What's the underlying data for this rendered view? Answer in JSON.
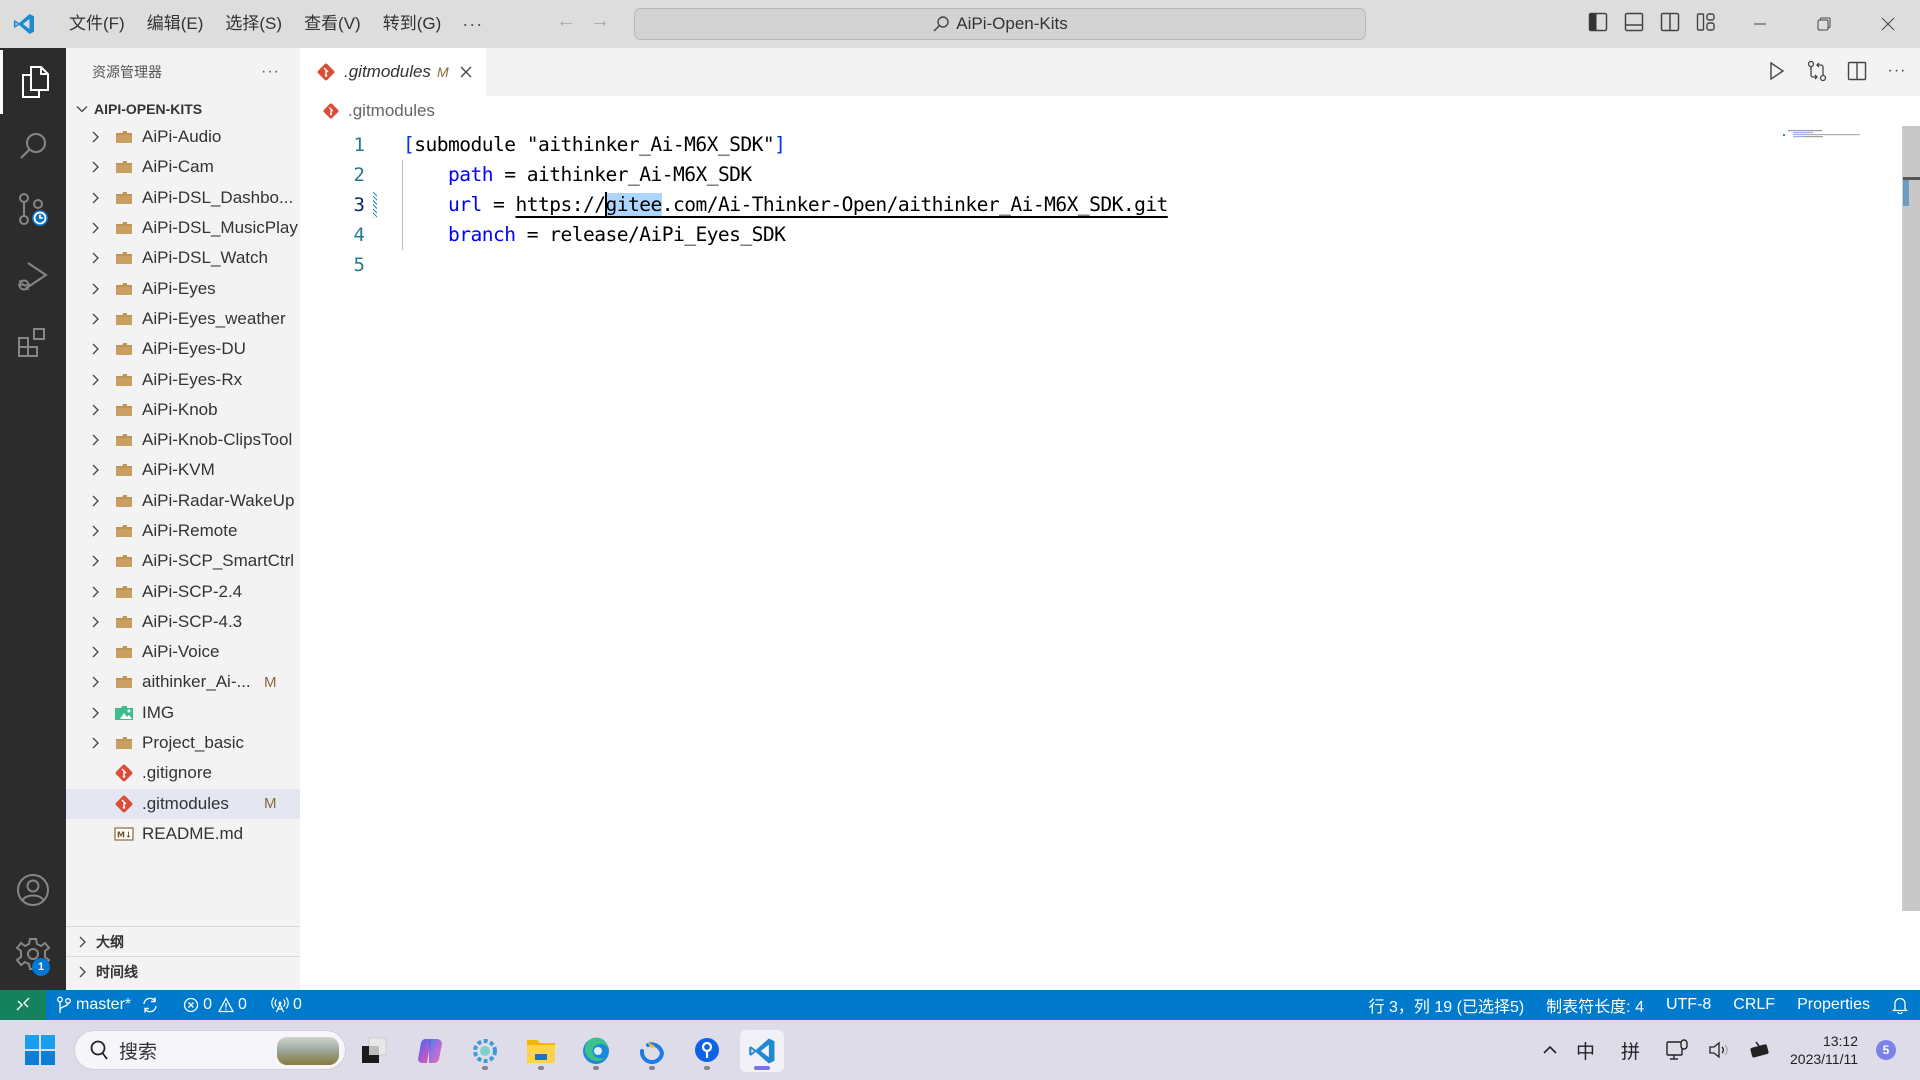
{
  "titlebar": {
    "menus": [
      "文件(F)",
      "编辑(E)",
      "选择(S)",
      "查看(V)",
      "转到(G)"
    ],
    "more_label": "···",
    "command_center_text": "AiPi-Open-Kits"
  },
  "activitybar": {
    "items": [
      {
        "name": "explorer",
        "icon": "files-icon",
        "active": true
      },
      {
        "name": "search",
        "icon": "search-icon"
      },
      {
        "name": "source-control",
        "icon": "source-control-icon"
      },
      {
        "name": "run-debug",
        "icon": "run-debug-icon"
      },
      {
        "name": "extensions",
        "icon": "extensions-icon"
      }
    ],
    "accounts_icon": "account-icon",
    "manage_icon": "gear-icon",
    "manage_badge": "1"
  },
  "sidebar": {
    "title": "资源管理器",
    "more_label": "···",
    "workspace_name": "AIPI-OPEN-KITS",
    "tree": [
      {
        "label": "AiPi-Audio",
        "type": "folder"
      },
      {
        "label": "AiPi-Cam",
        "type": "folder"
      },
      {
        "label": "AiPi-DSL_Dashbo...",
        "type": "folder"
      },
      {
        "label": "AiPi-DSL_MusicPlay",
        "type": "folder"
      },
      {
        "label": "AiPi-DSL_Watch",
        "type": "folder"
      },
      {
        "label": "AiPi-Eyes",
        "type": "folder"
      },
      {
        "label": "AiPi-Eyes_weather",
        "type": "folder"
      },
      {
        "label": "AiPi-Eyes-DU",
        "type": "folder"
      },
      {
        "label": "AiPi-Eyes-Rx",
        "type": "folder"
      },
      {
        "label": "AiPi-Knob",
        "type": "folder"
      },
      {
        "label": "AiPi-Knob-ClipsTool",
        "type": "folder"
      },
      {
        "label": "AiPi-KVM",
        "type": "folder"
      },
      {
        "label": "AiPi-Radar-WakeUp",
        "type": "folder"
      },
      {
        "label": "AiPi-Remote",
        "type": "folder"
      },
      {
        "label": "AiPi-SCP_SmartCtrl",
        "type": "folder"
      },
      {
        "label": "AiPi-SCP-2.4",
        "type": "folder"
      },
      {
        "label": "AiPi-SCP-4.3",
        "type": "folder"
      },
      {
        "label": "AiPi-Voice",
        "type": "folder"
      },
      {
        "label": "aithinker_Ai-...",
        "type": "folder",
        "decoration": "M"
      },
      {
        "label": "IMG",
        "type": "image-folder"
      },
      {
        "label": "Project_basic",
        "type": "folder"
      },
      {
        "label": ".gitignore",
        "type": "git-file"
      },
      {
        "label": ".gitmodules",
        "type": "git-file",
        "decoration": "M",
        "selected": true
      },
      {
        "label": "README.md",
        "type": "markdown-file"
      }
    ],
    "sections": [
      "大纲",
      "时间线"
    ]
  },
  "editor": {
    "tab": {
      "label": ".gitmodules",
      "decoration": "M"
    },
    "breadcrumb": ".gitmodules",
    "lines": [
      {
        "number": "1"
      },
      {
        "number": "2"
      },
      {
        "number": "3"
      },
      {
        "number": "4"
      },
      {
        "number": "5"
      }
    ],
    "code": {
      "l1_open": "[",
      "l1_body": "submodule \"aithinker_Ai-M6X_SDK\"",
      "l1_close": "]",
      "l2_key": "path",
      "l2_eq": " = ",
      "l2_val": "aithinker_Ai-M6X_SDK",
      "l3_key": "url",
      "l3_eq": " = ",
      "l3_url_pre": "https://",
      "l3_url_sel": "gitee",
      "l3_url_post": ".com/Ai-Thinker-Open/aithinker_Ai-M6X_SDK.git",
      "l4_key": "branch",
      "l4_eq": " = ",
      "l4_val": "release/AiPi_Eyes_SDK"
    }
  },
  "statusbar": {
    "branch": "master*",
    "errors": "0",
    "warnings": "0",
    "ports": "0",
    "cursor_position": "行 3，列 19 (已选择5)",
    "indentation": "制表符长度: 4",
    "encoding": "UTF-8",
    "eol": "CRLF",
    "language": "Properties"
  },
  "taskbar": {
    "search_placeholder": "搜索",
    "apps": [
      "task-view",
      "copilot",
      "settings-app",
      "file-explorer",
      "edge",
      "feishu",
      "maps-app",
      "vscode"
    ],
    "tray": {
      "ime_lang": "中",
      "ime_mode": "拼",
      "time": "13:12",
      "date": "2023/11/11",
      "notifications": "5"
    }
  }
}
